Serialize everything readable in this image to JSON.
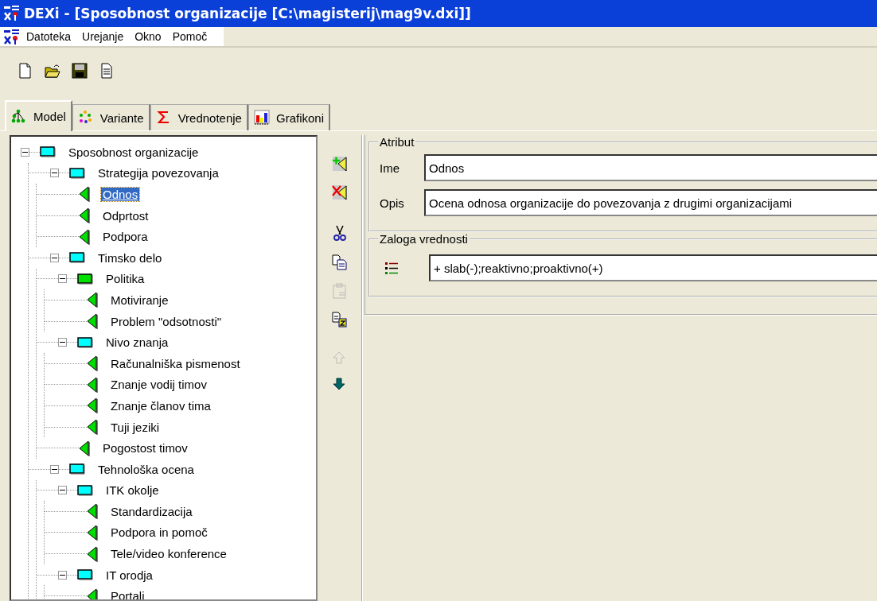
{
  "window": {
    "title": "DEXi - [Sposobnost organizacije [C:\\magisterij\\mag9v.dxi]]"
  },
  "menu": [
    "Datoteka",
    "Urejanje",
    "Okno",
    "Pomoč"
  ],
  "toolbar": [
    {
      "kind": "new"
    },
    {
      "kind": "open"
    },
    {
      "kind": "save"
    },
    {
      "kind": "report"
    }
  ],
  "tabs": [
    {
      "label": "Model",
      "kind": "model",
      "selected": true
    },
    {
      "label": "Variante",
      "kind": "variants",
      "selected": false
    },
    {
      "label": "Vrednotenje",
      "kind": "evaluation",
      "selected": false
    },
    {
      "label": "Grafikoni",
      "kind": "charts",
      "selected": false
    }
  ],
  "tree": [
    {
      "label": "Sposobnost organizacije",
      "kind": "aggregate",
      "color": "#00ffff",
      "expanded": true,
      "selected": false,
      "children": [
        {
          "label": "Strategija povezovanja",
          "kind": "aggregate",
          "color": "#00ffff",
          "expanded": true,
          "selected": false,
          "children": [
            {
              "label": "Odnos",
              "kind": "basic",
              "selected": true
            },
            {
              "label": "Odprtost",
              "kind": "basic",
              "selected": false
            },
            {
              "label": "Podpora",
              "kind": "basic",
              "selected": false
            }
          ]
        },
        {
          "label": "Timsko delo",
          "kind": "aggregate",
          "color": "#00ffff",
          "expanded": true,
          "selected": false,
          "children": [
            {
              "label": "Politika",
              "kind": "aggregate",
              "color": "#00e000",
              "expanded": true,
              "selected": false,
              "children": [
                {
                  "label": "Motiviranje",
                  "kind": "basic",
                  "selected": false
                },
                {
                  "label": "Problem \"odsotnosti\"",
                  "kind": "basic",
                  "selected": false
                }
              ]
            },
            {
              "label": "Nivo znanja",
              "kind": "aggregate",
              "color": "#00ffff",
              "expanded": true,
              "selected": false,
              "children": [
                {
                  "label": "Računalniška pismenost",
                  "kind": "basic",
                  "selected": false
                },
                {
                  "label": "Znanje vodij timov",
                  "kind": "basic",
                  "selected": false
                },
                {
                  "label": "Znanje članov tima",
                  "kind": "basic",
                  "selected": false
                },
                {
                  "label": "Tuji jeziki",
                  "kind": "basic",
                  "selected": false
                }
              ]
            },
            {
              "label": "Pogostost timov",
              "kind": "basic",
              "selected": false
            }
          ]
        },
        {
          "label": "Tehnološka ocena",
          "kind": "aggregate",
          "color": "#00ffff",
          "expanded": true,
          "selected": false,
          "children": [
            {
              "label": "ITK okolje",
              "kind": "aggregate",
              "color": "#00ffff",
              "expanded": true,
              "selected": false,
              "children": [
                {
                  "label": "Standardizacija",
                  "kind": "basic",
                  "selected": false
                },
                {
                  "label": "Podpora in pomoč",
                  "kind": "basic",
                  "selected": false
                },
                {
                  "label": "Tele/video konference",
                  "kind": "basic",
                  "selected": false
                }
              ]
            },
            {
              "label": "IT orodja",
              "kind": "aggregate",
              "color": "#00ffff",
              "expanded": true,
              "selected": false,
              "children": [
                {
                  "label": "Portali",
                  "kind": "basic",
                  "selected": false
                }
              ]
            }
          ]
        }
      ]
    }
  ],
  "tree_buttons": [
    {
      "kind": "add",
      "disabled": false
    },
    {
      "kind": "delete",
      "disabled": false
    },
    {
      "kind": "cut",
      "disabled": false
    },
    {
      "kind": "copy",
      "disabled": false
    },
    {
      "kind": "paste",
      "disabled": true
    },
    {
      "kind": "duplicate",
      "disabled": false
    },
    {
      "kind": "up",
      "disabled": true
    },
    {
      "kind": "down",
      "disabled": false
    }
  ],
  "attribute": {
    "title": "Atribut",
    "name_label": "Ime",
    "name": "Odnos",
    "description_label": "Opis",
    "description": "Ocena odnosa organizacije do povezovanja z drugimi organizacijami"
  },
  "scale": {
    "title": "Zaloga vrednosti",
    "value": "+ slab(-);reaktivno;proaktivno(+)"
  }
}
